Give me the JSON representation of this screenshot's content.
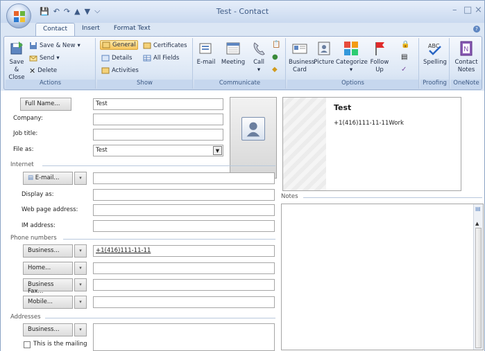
{
  "window": {
    "title": "Test - Contact"
  },
  "quick_access": [
    "save-icon",
    "undo-icon",
    "redo-icon",
    "up-arrow-icon",
    "down-arrow-icon",
    "customize-icon"
  ],
  "tabs": [
    {
      "label": "Contact",
      "active": true
    },
    {
      "label": "Insert",
      "active": false
    },
    {
      "label": "Format Text",
      "active": false
    }
  ],
  "ribbon": {
    "actions": {
      "label": "Actions",
      "save_close": "Save & Close",
      "save_new": "Save & New",
      "send": "Send",
      "delete": "Delete"
    },
    "show": {
      "label": "Show",
      "general": "General",
      "details": "Details",
      "activities": "Activities",
      "certificates": "Certificates",
      "all_fields": "All Fields"
    },
    "communicate": {
      "label": "Communicate",
      "email": "E-mail",
      "meeting": "Meeting",
      "call": "Call"
    },
    "options": {
      "label": "Options",
      "business_card": "Business Card",
      "picture": "Picture",
      "categorize": "Categorize",
      "follow_up": "Follow Up"
    },
    "proofing": {
      "label": "Proofing",
      "spelling": "Spelling"
    },
    "onenote": {
      "label": "OneNote",
      "contact_notes": "Contact Notes"
    }
  },
  "form": {
    "full_name_button": "Full Name...",
    "full_name_value": "Test",
    "company_label": "Company:",
    "company_value": "",
    "job_title_label": "Job title:",
    "job_title_value": "",
    "file_as_label": "File as:",
    "file_as_value": "Test",
    "internet_section": "Internet",
    "email_button": "E-mail...",
    "email_value": "",
    "display_as_label": "Display as:",
    "display_as_value": "",
    "web_page_label": "Web page address:",
    "web_page_value": "",
    "im_label": "IM address:",
    "im_value": "",
    "phone_section": "Phone numbers",
    "phones": [
      {
        "button": "Business...",
        "value": "+1(416)111-11-11"
      },
      {
        "button": "Home...",
        "value": ""
      },
      {
        "button": "Business Fax...",
        "value": ""
      },
      {
        "button": "Mobile...",
        "value": ""
      }
    ],
    "addresses_section": "Addresses",
    "address_button": "Business...",
    "address_value": "",
    "mailing_checkbox": "This is the mailing",
    "notes_section": "Notes",
    "notes_value": ""
  },
  "business_card": {
    "name": "Test",
    "phone": "+1(416)111-11-11",
    "phone_type": "Work"
  },
  "colors": {
    "accent": "#5e86c1",
    "selected": "#f7c45b",
    "ribbon_bg": "#dce7f5"
  }
}
